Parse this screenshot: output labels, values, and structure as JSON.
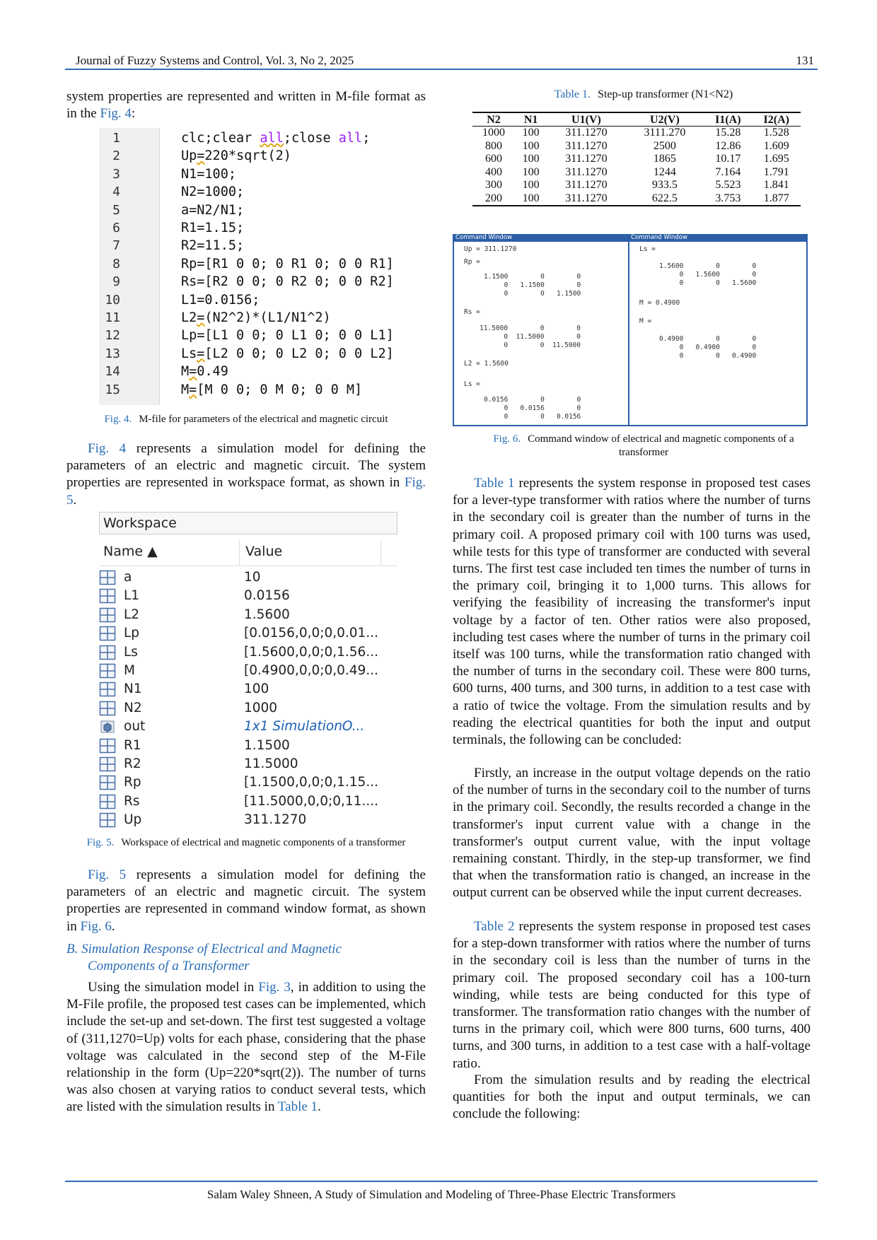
{
  "header": {
    "journal": "Journal of Fuzzy Systems and Control, Vol. 3, No 2, 2025",
    "page": "131"
  },
  "footer": "Salam Waley Shneen, A Study of Simulation and Modeling of Three-Phase Electric Transformers",
  "left": {
    "p1": {
      "a": "system properties are represented and written in M-file format as in the ",
      "link": "Fig. 4",
      "b": ":"
    },
    "code_lines": [
      {
        "n": "1",
        "parts": [
          {
            "t": "clc;clear "
          },
          {
            "t": "all",
            "k": "kwsq"
          },
          {
            "t": ";close "
          },
          {
            "t": "all",
            "k": "kw"
          },
          {
            "t": ";"
          }
        ]
      },
      {
        "n": "2",
        "parts": [
          {
            "t": "Up"
          },
          {
            "t": "=",
            "k": "sq"
          },
          {
            "t": "220*sqrt(2)"
          }
        ]
      },
      {
        "n": "3",
        "parts": [
          {
            "t": "N1=100;"
          }
        ]
      },
      {
        "n": "4",
        "parts": [
          {
            "t": "N2=1000;"
          }
        ]
      },
      {
        "n": "5",
        "parts": [
          {
            "t": "a=N2/N1;"
          }
        ]
      },
      {
        "n": "6",
        "parts": [
          {
            "t": "R1=1.15;"
          }
        ]
      },
      {
        "n": "7",
        "parts": [
          {
            "t": "R2=11.5;"
          }
        ]
      },
      {
        "n": "8",
        "parts": [
          {
            "t": "Rp=[R1 0 0; 0 R1 0; 0 0 R1]"
          }
        ]
      },
      {
        "n": "9",
        "parts": [
          {
            "t": "Rs=[R2 0 0; 0 R2 0; 0 0 R2]"
          }
        ]
      },
      {
        "n": "10",
        "parts": [
          {
            "t": "L1=0.0156;"
          }
        ]
      },
      {
        "n": "11",
        "parts": [
          {
            "t": "L2"
          },
          {
            "t": "=",
            "k": "sq"
          },
          {
            "t": "(N2^2)*(L1/N1^2)"
          }
        ]
      },
      {
        "n": "12",
        "parts": [
          {
            "t": "Lp=[L1 0 0; 0 L1 0; 0 0 L1]"
          }
        ]
      },
      {
        "n": "13",
        "parts": [
          {
            "t": "Ls"
          },
          {
            "t": "=",
            "k": "sq"
          },
          {
            "t": "[L2 0 0; 0 L2 0; 0 0 L2]"
          }
        ]
      },
      {
        "n": "14",
        "parts": [
          {
            "t": "M"
          },
          {
            "t": "=",
            "k": "sq"
          },
          {
            "t": "0.49"
          }
        ]
      },
      {
        "n": "15",
        "parts": [
          {
            "t": "M"
          },
          {
            "t": "=",
            "k": "sq"
          },
          {
            "t": "[M 0 0; 0 M 0; 0 0 M]"
          }
        ]
      }
    ],
    "fig4_cap": {
      "label": "Fig. 4.",
      "text": "M-file for parameters of the electrical and magnetic circuit"
    },
    "p2": {
      "link1": "Fig. 4",
      "a": " represents a simulation model for defining the parameters of an electric and magnetic circuit. The system properties are represented in workspace format, as shown in ",
      "link2": "Fig. 5",
      "b": "."
    },
    "workspace": {
      "title": "Workspace",
      "col_name": "Name ▲",
      "col_value": "Value",
      "rows": [
        {
          "name": "a",
          "value": "10",
          "type": "num"
        },
        {
          "name": "L1",
          "value": "0.0156",
          "type": "num"
        },
        {
          "name": "L2",
          "value": "1.5600",
          "type": "num"
        },
        {
          "name": "Lp",
          "value": "[0.0156,0,0;0,0.01...",
          "type": "num"
        },
        {
          "name": "Ls",
          "value": "[1.5600,0,0;0,1.56...",
          "type": "num"
        },
        {
          "name": "M",
          "value": "[0.4900,0,0;0,0.49...",
          "type": "num"
        },
        {
          "name": "N1",
          "value": "100",
          "type": "num"
        },
        {
          "name": "N2",
          "value": "1000",
          "type": "num"
        },
        {
          "name": "out",
          "value": "1x1 SimulationO...",
          "type": "obj"
        },
        {
          "name": "R1",
          "value": "1.1500",
          "type": "num"
        },
        {
          "name": "R2",
          "value": "11.5000",
          "type": "num"
        },
        {
          "name": "Rp",
          "value": "[1.1500,0,0;0,1.15...",
          "type": "num"
        },
        {
          "name": "Rs",
          "value": "[11.5000,0,0;0,11....",
          "type": "num"
        },
        {
          "name": "Up",
          "value": "311.1270",
          "type": "num"
        }
      ]
    },
    "fig5_cap": {
      "label": "Fig. 5.",
      "text": "Workspace of electrical and magnetic components of a transformer"
    },
    "p3": {
      "link1": "Fig. 5",
      "a": " represents a simulation model for defining the parameters of an electric and magnetic circuit. The system properties are represented in command window format, as shown in ",
      "link2": "Fig. 6",
      "b": "."
    },
    "section": {
      "line1": "B.  Simulation Response of Electrical and Magnetic",
      "line2": "Components of a Transformer"
    },
    "p4": {
      "a": "Using the simulation model in ",
      "link1": "Fig. 3",
      "b": ", in addition to using the M-File profile, the proposed test cases can be implemented, which include the set-up and set-down. The first test suggested a voltage of (311,1270=Up) volts for each phase, considering that the phase voltage was calculated in the second step of the M-File relationship in the form (Up=220*sqrt(2)). The number of turns was also chosen at varying ratios to conduct several tests, which are listed with the simulation results in ",
      "link2": "Table 1",
      "c": "."
    }
  },
  "right": {
    "table1_cap": {
      "label": "Table 1.",
      "text": "Step-up transformer (N1<N2)"
    },
    "table1": {
      "headers": [
        "N2",
        "N1",
        "U1(V)",
        "U2(V)",
        "I1(A)",
        "I2(A)"
      ],
      "rows": [
        [
          "1000",
          "100",
          "311.1270",
          "3111.270",
          "15.28",
          "1.528"
        ],
        [
          "800",
          "100",
          "311.1270",
          "2500",
          "12.86",
          "1.609"
        ],
        [
          "600",
          "100",
          "311.1270",
          "1865",
          "10.17",
          "1.695"
        ],
        [
          "400",
          "100",
          "311.1270",
          "1244",
          "7.164",
          "1.791"
        ],
        [
          "300",
          "100",
          "311.1270",
          "933.5",
          "5.523",
          "1.841"
        ],
        [
          "200",
          "100",
          "311.1270",
          "622.5",
          "3.753",
          "1.877"
        ]
      ]
    },
    "cw1": {
      "title": "Command Window",
      "lines": [
        "Up = 311.1270",
        "Rp =",
        "1.1500        0        0",
        "     0   1.1500        0",
        "     0        0   1.1500",
        "Rs =",
        "11.5000        0        0",
        "      0  11.5000        0",
        "      0        0  11.5000",
        "L2 = 1.5600",
        "Ls =",
        "0.0156        0        0",
        "     0   0.0156        0",
        "     0        0   0.0156"
      ]
    },
    "cw2": {
      "title": "Command Window",
      "lines": [
        "Ls =",
        "1.5600        0        0",
        "     0   1.5600        0",
        "     0        0   1.5600",
        "M = 0.4900",
        "M =",
        "0.4900        0        0",
        "     0   0.4900        0",
        "     0        0   0.4900"
      ]
    },
    "fig6_cap": {
      "label": "Fig. 6.",
      "text1": "Command window of electrical and magnetic components of a",
      "text2": "transformer"
    },
    "p5": {
      "link": "Table 1",
      "a": " represents the system response in proposed test cases for a lever-type transformer with ratios where the number of turns in the secondary coil is greater than the number of turns in the primary coil. A proposed primary coil with 100 turns was used, while tests for this type of transformer are conducted with several turns. The first test case included ten times the number of turns in the primary coil, bringing it to 1,000 turns. This allows for verifying the feasibility of increasing the transformer's input voltage by a factor of ten. Other ratios were also proposed, including test cases where the number of turns in the primary coil itself was 100 turns, while the transformation ratio changed with the number of turns in the secondary coil. These were 800 turns, 600 turns, 400 turns, and 300 turns, in addition to a test case with a ratio of twice the voltage. From the simulation results and by reading the electrical quantities for both the input and output terminals, the following can be concluded:"
    },
    "p6": "Firstly, an increase in the output voltage depends on the ratio of the number of turns in the secondary coil to the number of turns in the primary coil. Secondly, the results recorded a change in the transformer's input current value with a change in the transformer's output current value, with the input voltage remaining constant. Thirdly, in the step-up transformer, we find that when the transformation ratio is changed, an increase in the output current can be observed while the input current decreases.",
    "p7": {
      "link": "Table 2",
      "a": " represents the system response in proposed test cases for a step-down transformer with ratios where the number of turns in the secondary coil is less than the number of turns in the primary coil. The proposed secondary coil has a 100-turn winding, while tests are being conducted for this type of transformer. The transformation ratio changes with the number of turns in the primary coil, which were 800 turns, 600 turns, 400 turns, and 300 turns, in addition to a test case with a half-voltage ratio."
    },
    "p8": "From the simulation results and by reading the electrical quantities for both the input and output terminals, we can conclude the following:"
  },
  "colors": {
    "link": "#2a6db5",
    "rule": "#2a6db5",
    "cw_header": "#2d5fa8",
    "keyword": "#a020f0"
  }
}
